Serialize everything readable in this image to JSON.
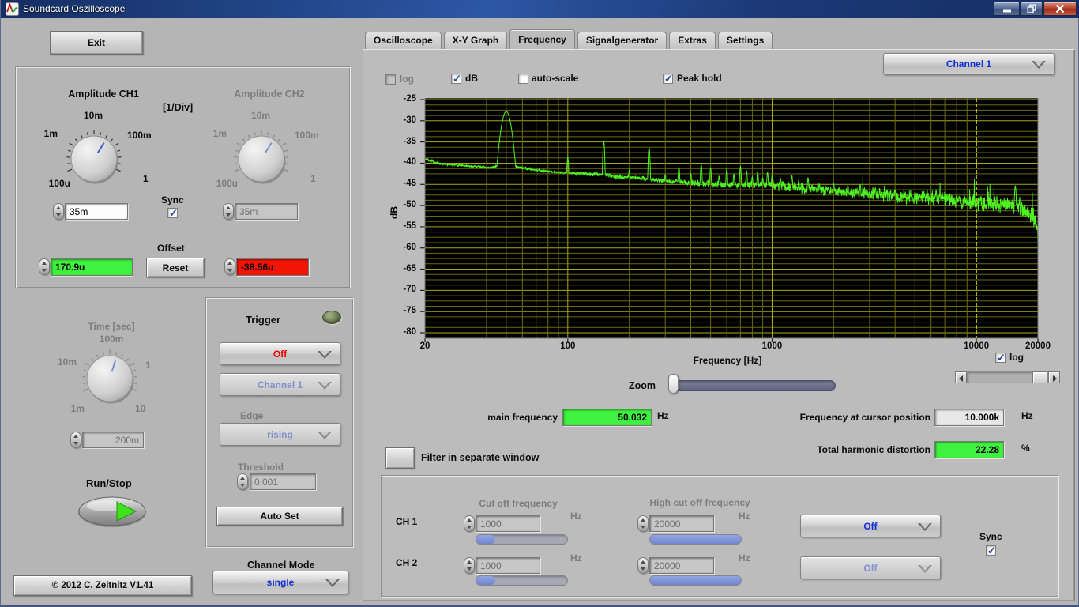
{
  "window": {
    "title": "Soundcard Oszilloscope"
  },
  "left": {
    "exit": "Exit",
    "amp": {
      "ch1_title": "Amplitude CH1",
      "div": "[1/Div]",
      "ch2_title": "Amplitude CH2",
      "ticks": [
        "100u",
        "1m",
        "10m",
        "100m",
        "1"
      ],
      "ch1_value": "35m",
      "ch2_value": "35m",
      "sync": "Sync",
      "offset": "Offset",
      "ch1_offset": "170.9u",
      "reset": "Reset",
      "ch2_offset": "-38.56u"
    },
    "time": {
      "title": "Time [sec]",
      "ticks": [
        "1m",
        "10m",
        "100m",
        "1",
        "10"
      ],
      "value": "200m"
    },
    "runstop": "Run/Stop",
    "trigger": {
      "title": "Trigger",
      "mode": "Off",
      "channel": "Channel 1",
      "edge_label": "Edge",
      "edge": "rising",
      "threshold_label": "Threshold",
      "threshold": "0.001",
      "autoset": "Auto Set"
    },
    "channel_mode_label": "Channel Mode",
    "channel_mode": "single",
    "copyright": "© 2012   C. Zeitnitz V1.41"
  },
  "tabs": [
    "Oscilloscope",
    "X-Y Graph",
    "Frequency",
    "Signalgenerator",
    "Extras",
    "Settings"
  ],
  "freq": {
    "log": "log",
    "db": "dB",
    "autoscale": "auto-scale",
    "peakhold": "Peak hold",
    "channel": "Channel 1",
    "xlog": "log",
    "zoom": "Zoom",
    "mainfreq_label": "main frequency",
    "mainfreq": "50.032",
    "hz": "Hz",
    "cursor_label": "Frequency at cursor position",
    "cursor_value": "10.000k",
    "thd_label": "Total harmonic distortion",
    "thd": "22.28",
    "pct": "%",
    "filterwin": "Filter in separate window",
    "filter": {
      "cutoff": "Cut off frequency",
      "highcut": "High cut off frequency",
      "ch1": "CH 1",
      "ch2": "CH 2",
      "ch1_cut": "1000",
      "ch1_high": "20000",
      "ch2_cut": "1000",
      "ch2_high": "20000",
      "hz": "Hz",
      "ch1_mode": "Off",
      "ch2_mode": "Off",
      "sync": "Sync"
    }
  },
  "chart_data": {
    "type": "line",
    "title": "",
    "xlabel": "Frequency [Hz]",
    "ylabel": "dB",
    "x_scale": "log",
    "xlim": [
      20,
      20000
    ],
    "ylim": [
      -80,
      -25
    ],
    "y_ticks": [
      -25,
      -30,
      -35,
      -40,
      -45,
      -50,
      -55,
      -60,
      -65,
      -70,
      -75,
      -80
    ],
    "x_ticks": [
      20,
      100,
      1000,
      10000,
      20000
    ],
    "grid": true,
    "legend": "none",
    "cursor_frequency_hz": 10000,
    "series_name": "Channel 1 peak-hold spectrum",
    "series_color": "#4ef321",
    "grid_minor_color": "#6b6b08",
    "grid_major_color": "#a8a818",
    "cursor_color": "#ffff00",
    "plot_bg": "#000000",
    "main_peak": [
      50,
      -27.8
    ],
    "noise_floor": [
      [
        20,
        -39.0
      ],
      [
        24,
        -40.2
      ],
      [
        30,
        -40.5
      ],
      [
        36,
        -40.8
      ],
      [
        42,
        -41.0
      ],
      [
        47,
        -40.6
      ],
      [
        55,
        -40.7
      ],
      [
        62,
        -41.2
      ],
      [
        75,
        -41.8
      ],
      [
        90,
        -42.2
      ],
      [
        110,
        -42.4
      ],
      [
        140,
        -42.6
      ],
      [
        180,
        -43.2
      ],
      [
        230,
        -43.6
      ],
      [
        300,
        -44.2
      ],
      [
        400,
        -44.6
      ],
      [
        520,
        -45.0
      ],
      [
        700,
        -45.2
      ],
      [
        900,
        -45.0
      ],
      [
        1200,
        -45.6
      ],
      [
        1600,
        -46.2
      ],
      [
        2200,
        -46.8
      ],
      [
        3000,
        -47.2
      ],
      [
        4500,
        -47.9
      ],
      [
        6500,
        -48.4
      ],
      [
        9000,
        -49.0
      ],
      [
        12000,
        -49.6
      ],
      [
        15000,
        -50.2
      ],
      [
        17500,
        -51.0
      ],
      [
        19000,
        -52.5
      ],
      [
        19700,
        -55.0
      ],
      [
        20000,
        -57.5
      ]
    ],
    "harmonics": [
      [
        50,
        -27.8
      ],
      [
        100,
        -38.6
      ],
      [
        150,
        -35.0
      ],
      [
        200,
        -41.5
      ],
      [
        250,
        -36.3
      ],
      [
        300,
        -42.6
      ],
      [
        350,
        -40.9
      ],
      [
        400,
        -42.4
      ],
      [
        450,
        -40.4
      ],
      [
        500,
        -41.2
      ],
      [
        550,
        -43.0
      ],
      [
        600,
        -41.3
      ],
      [
        650,
        -42.6
      ],
      [
        700,
        -40.8
      ],
      [
        750,
        -41.9
      ],
      [
        800,
        -43.2
      ],
      [
        850,
        -42.0
      ],
      [
        900,
        -43.4
      ],
      [
        950,
        -42.2
      ],
      [
        1000,
        -42.9
      ],
      [
        1100,
        -43.6
      ],
      [
        1250,
        -42.8
      ],
      [
        1350,
        -44.0
      ],
      [
        1500,
        -43.4
      ],
      [
        1700,
        -44.8
      ],
      [
        2000,
        -44.6
      ],
      [
        2350,
        -45.2
      ],
      [
        2700,
        -45.0
      ],
      [
        3200,
        -45.8
      ],
      [
        4000,
        -46.2
      ],
      [
        5000,
        -46.8
      ],
      [
        6350,
        -46.4
      ],
      [
        8000,
        -47.5
      ],
      [
        15500,
        -45.3
      ]
    ]
  }
}
